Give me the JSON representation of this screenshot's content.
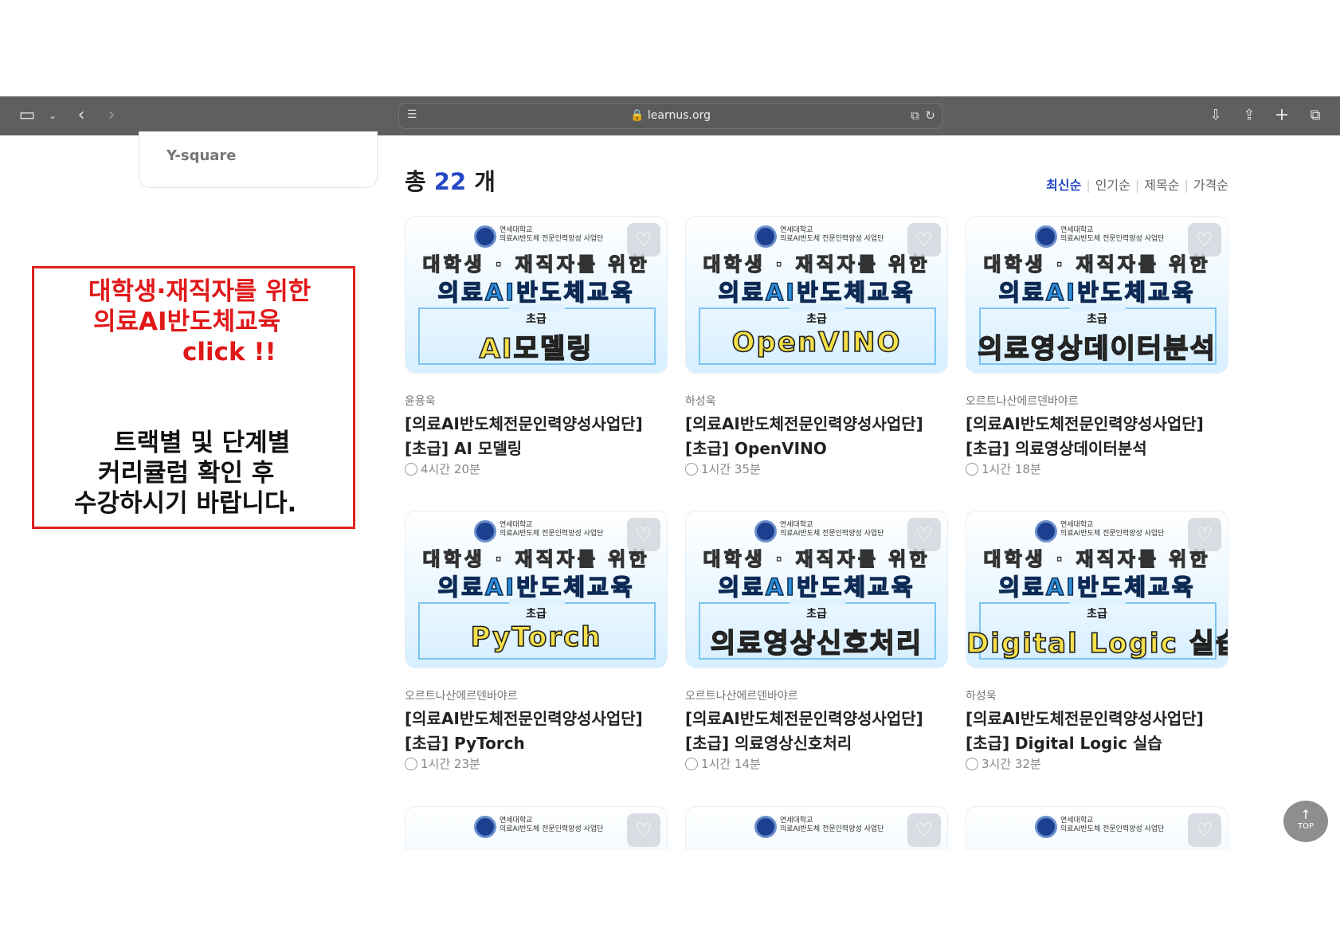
{
  "browser": {
    "url": "learnus.org"
  },
  "sidebar": {
    "card_label": "Y-square"
  },
  "listing": {
    "count_prefix": "총",
    "count": "22",
    "count_suffix": "개",
    "sort_options": [
      "최신순",
      "인기순",
      "제목순",
      "가격순"
    ],
    "active_sort": "최신순"
  },
  "callout": {
    "line1": "대학생·재직자를 위한",
    "line2": "의료AI반도체교육",
    "line3": "click !!",
    "line4": "트랙별 및 단계별",
    "line5": "커리큘럼 확인 후",
    "line6": "수강하시기 바랍니다."
  },
  "thumb_common": {
    "logo_text": "연세대학교\n의료AI반도체 전문인력양성 사업단",
    "line1": "대학생 · 재직자를 위한",
    "line2": "의료AI반도체교육",
    "level": "초급"
  },
  "courses": [
    {
      "subject": "AI모델링",
      "instructor": "윤용욱",
      "title": "[의료AI반도체전문인력양성사업단]\n[초급] AI 모델링",
      "duration": "4시간 20분"
    },
    {
      "subject": "OpenVINO",
      "instructor": "하성욱",
      "title": "[의료AI반도체전문인력양성사업단]\n[초급] OpenVINO",
      "duration": "1시간 35분"
    },
    {
      "subject": "의료영상데이터분석",
      "instructor": "오르트나산에르덴바야르",
      "title": "[의료AI반도체전문인력양성사업단]\n[초급] 의료영상데이터분석",
      "duration": "1시간 18분"
    },
    {
      "subject": "PyTorch",
      "instructor": "오르트나산에르덴바야르",
      "title": "[의료AI반도체전문인력양성사업단]\n[초급] PyTorch",
      "duration": "1시간 23분"
    },
    {
      "subject": "의료영상신호처리",
      "instructor": "오르트나산에르덴바야르",
      "title": "[의료AI반도체전문인력양성사업단]\n[초급] 의료영상신호처리",
      "duration": "1시간 14분"
    },
    {
      "subject": "Digital Logic 실습",
      "instructor": "하성욱",
      "title": "[의료AI반도체전문인력양성사업단]\n[초급] Digital Logic 실습",
      "duration": "3시간 32분"
    }
  ],
  "top_button": "TOP"
}
